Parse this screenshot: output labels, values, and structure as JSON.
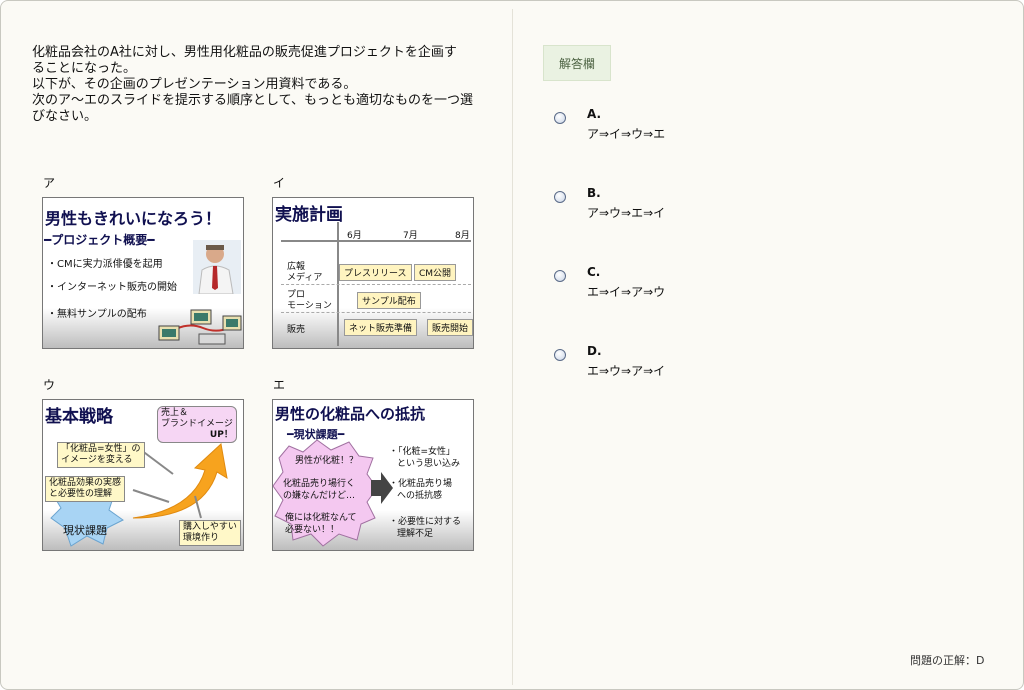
{
  "question": {
    "lines": [
      "化粧品会社のA社に対し、男性用化粧品の販売促進プロジェクトを企画す",
      "ることになった。",
      "以下が、その企画のプレゼンテーション用資料である。",
      "次のア～エのスライドを提示する順序として、もっとも適切なものを一つ選",
      "びなさい。"
    ]
  },
  "slides": {
    "a": {
      "label": "ア",
      "title": "男性もきれいになろう！",
      "subtitle": "━プロジェクト概要━",
      "bullets": [
        "・CMに実力派俳優を起用",
        "・インターネット販売の開始",
        "・無料サンプルの配布"
      ]
    },
    "i": {
      "label": "イ",
      "title": "実施計画",
      "months": [
        "6月",
        "7月",
        "8月"
      ],
      "rows": [
        "広報",
        "メディア",
        "プロ",
        "モーション",
        "販売"
      ],
      "bars": [
        "プレスリリース",
        "CM公開",
        "サンプル配布",
        "ネット販売準備",
        "販売開始"
      ]
    },
    "u": {
      "label": "ウ",
      "title": "基本戦略",
      "goal_line1": "売上＆",
      "goal_line2": "ブランドイメージ",
      "goal_line3": "UP！",
      "box1_line1": "「化粧品=女性」の",
      "box1_line2": "イメージを変える",
      "box2_line1": "化粧品効果の実感",
      "box2_line2": "と必要性の理解",
      "box3_line1": "購入しやすい",
      "box3_line2": "環境作り",
      "current": "現状課題"
    },
    "e": {
      "label": "エ",
      "title": "男性の化粧品への抵抗",
      "subtitle": "━現状課題━",
      "bubble_lines": [
        "男性が化粧！？",
        "化粧品売り場行く",
        "の嫌なんだけど…",
        "俺には化粧なんて",
        "必要ない！！"
      ],
      "points": [
        "・「化粧=女性」",
        "という思い込み",
        "・化粧品売り場",
        "への抵抗感",
        "・必要性に対する",
        "理解不足"
      ]
    }
  },
  "answer": {
    "header": "解答欄",
    "options": [
      {
        "letter": "A.",
        "sequence": "ア⇒イ⇒ウ⇒エ"
      },
      {
        "letter": "B.",
        "sequence": "ア⇒ウ⇒エ⇒イ"
      },
      {
        "letter": "C.",
        "sequence": "エ⇒イ⇒ア⇒ウ"
      },
      {
        "letter": "D.",
        "sequence": "エ⇒ウ⇒ア⇒イ"
      }
    ]
  },
  "footer": {
    "correct_answer": "問題の正解：D"
  }
}
